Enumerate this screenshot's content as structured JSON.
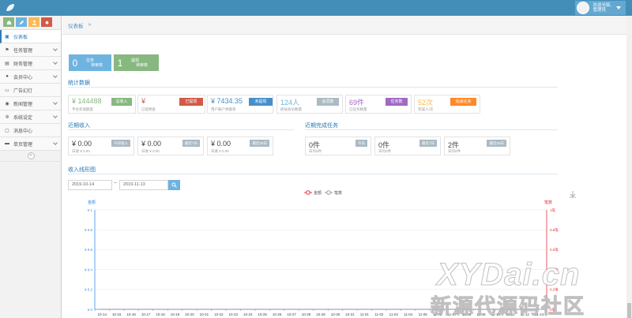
{
  "header": {
    "welcome": "欢迎光临,",
    "username": "管理员"
  },
  "shortcuts": [
    {
      "icon": "home-icon",
      "color": "#87b87f"
    },
    {
      "icon": "pencil-icon",
      "color": "#6fb3e0"
    },
    {
      "icon": "users-icon",
      "color": "#ffb752"
    },
    {
      "icon": "bell-icon",
      "color": "#d15b47"
    }
  ],
  "sidebar": {
    "items": [
      {
        "label": "仪表板",
        "icon": "dashboard-icon",
        "active": true
      },
      {
        "label": "任务管理",
        "icon": "flag-icon"
      },
      {
        "label": "财务管理",
        "icon": "finance-icon"
      },
      {
        "label": "会员中心",
        "icon": "user-icon"
      },
      {
        "label": "广告幻灯",
        "icon": "image-icon"
      },
      {
        "label": "新闻管理",
        "icon": "news-icon"
      },
      {
        "label": "系统设定",
        "icon": "settings-icon"
      },
      {
        "label": "消息中心",
        "icon": "message-icon"
      },
      {
        "label": "单页管理",
        "icon": "page-icon"
      }
    ]
  },
  "breadcrumb": {
    "current": "仪表板",
    "separator": "»"
  },
  "tasks": [
    {
      "count": "0",
      "label1": "任务",
      "label2": "待审核",
      "color": "#6fb3e0"
    },
    {
      "count": "1",
      "label1": "提现",
      "label2": "待审核",
      "color": "#87b87f"
    }
  ],
  "sections": {
    "stats": "统计数据",
    "income": "近期收入",
    "done": "近期完成任务",
    "chart": "收入线形图"
  },
  "stats": [
    {
      "value": "¥ 144488",
      "sub": "平台充值额度",
      "badge": "总收入",
      "value_color": "#87b87f",
      "badge_color": "#87b87f"
    },
    {
      "value": "¥",
      "sub": "已提佣金",
      "badge": "已提现",
      "value_color": "#d15b47",
      "badge_color": "#d15b47"
    },
    {
      "value": "¥ 7434.35",
      "sub": "用户账户余额等",
      "badge": "未提现",
      "value_color": "#478fca",
      "badge_color": "#478fca"
    },
    {
      "value": "124人",
      "sub": "即站会员数量",
      "badge": "会员数",
      "value_color": "#6fb3e0",
      "badge_color": "#abbac3"
    },
    {
      "value": "69件",
      "sub": "已任务数量",
      "badge": "任务数",
      "value_color": "#a069c3",
      "badge_color": "#a069c3"
    },
    {
      "value": "52次",
      "sub": "完成人/次",
      "badge": "完成任务",
      "value_color": "#ffb752",
      "badge_color": "#ff892a"
    }
  ],
  "income": [
    {
      "value": "¥ 0.00",
      "sub": "日收 ¥ 0.00",
      "badge": "今日收入"
    },
    {
      "value": "¥ 0.00",
      "sub": "日收 ¥ 0.00",
      "badge": "最近7日"
    },
    {
      "value": "¥ 0.00",
      "sub": "日收 ¥ 0.00",
      "badge": "最近30日"
    }
  ],
  "done": [
    {
      "value": "0件",
      "sub": "日均0件",
      "badge": "今日"
    },
    {
      "value": "0件",
      "sub": "日均0件",
      "badge": "最近7日"
    },
    {
      "value": "2件",
      "sub": "日均0件",
      "badge": "最近30日"
    }
  ],
  "date_filter": {
    "start": "2019-10-14",
    "separator": "--",
    "end": "2019-11-13"
  },
  "watermark": {
    "line1": "XYDai.cn",
    "line2": "新源代源码社区"
  },
  "chart_data": {
    "type": "line",
    "legend": [
      "金额",
      "笔数"
    ],
    "legend_placement": "top-center",
    "categories": [
      "10-14",
      "10-15",
      "10-16",
      "10-17",
      "10-18",
      "10-19",
      "10-20",
      "10-21",
      "10-22",
      "10-23",
      "10-24",
      "10-25",
      "10-26",
      "10-27",
      "10-28",
      "10-29",
      "10-30",
      "10-31",
      "11-01",
      "11-02",
      "11-03",
      "11-04",
      "11-05",
      "11-06",
      "11-07",
      "11-08",
      "11-09",
      "11-10",
      "11-11",
      "11-12",
      "11-13"
    ],
    "series": [
      {
        "name": "金额",
        "color": "#e5323e",
        "axis": "left",
        "values": [
          0,
          0,
          0,
          0,
          0,
          0,
          0,
          0,
          0,
          0,
          0,
          0,
          0,
          0,
          0,
          0,
          0,
          0,
          0,
          0,
          0,
          0,
          0,
          0,
          0,
          0,
          0,
          0,
          0,
          0,
          0
        ]
      },
      {
        "name": "笔数",
        "color": "#8e9aa6",
        "axis": "right",
        "values": [
          0,
          0,
          0,
          0,
          0,
          0,
          0,
          0,
          0,
          0,
          0,
          0,
          0,
          0,
          0,
          0,
          0,
          0,
          0,
          0,
          0,
          0,
          0,
          0,
          0,
          0,
          0,
          0,
          0,
          0,
          0
        ]
      }
    ],
    "left_axis": {
      "label": "金额",
      "ticks": [
        "¥ 0",
        "¥ 0.2",
        "¥ 0.4",
        "¥ 0.6",
        "¥ 0.8",
        "¥ 1"
      ],
      "ylim": [
        0,
        1
      ],
      "color": "#3a8ee6"
    },
    "right_axis": {
      "label": "笔数",
      "ticks": [
        "0笔",
        "0.2笔",
        "0.4笔",
        "0.6笔",
        "0.8笔",
        "1笔"
      ],
      "ylim": [
        0,
        1
      ],
      "color": "#e5323e"
    },
    "grid": true
  }
}
